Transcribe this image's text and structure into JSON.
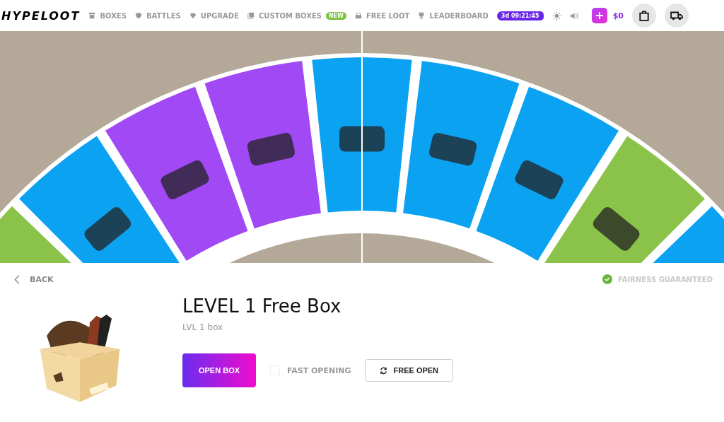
{
  "logo": "HYPELOOT",
  "nav": [
    {
      "label": "BOXES"
    },
    {
      "label": "BATTLES"
    },
    {
      "label": "UPGRADE"
    },
    {
      "label": "CUSTOM BOXES",
      "badge": "NEW"
    },
    {
      "label": "FREE LOOT"
    },
    {
      "label": "LEADERBOARD"
    }
  ],
  "timer": "3d 09:21:45",
  "balance": "$0",
  "wheel": {
    "segments": [
      {
        "color": "#8bc34a"
      },
      {
        "color": "#0ba2f2"
      },
      {
        "color": "#a049f5"
      },
      {
        "color": "#a049f5"
      },
      {
        "color": "#0ba2f2"
      },
      {
        "color": "#0ba2f2"
      },
      {
        "color": "#0ba2f2"
      },
      {
        "color": "#8bc34a"
      },
      {
        "color": "#0ba2f2"
      }
    ]
  },
  "back": "BACK",
  "fairness": "FAIRNESS GUARANTEED",
  "box": {
    "title": "LEVEL 1 Free Box",
    "subtitle": "LVL 1 box"
  },
  "open_button": "OPEN BOX",
  "fast_opening": {
    "label": "FAST OPENING",
    "checked": false
  },
  "free_open_button": "FREE OPEN"
}
